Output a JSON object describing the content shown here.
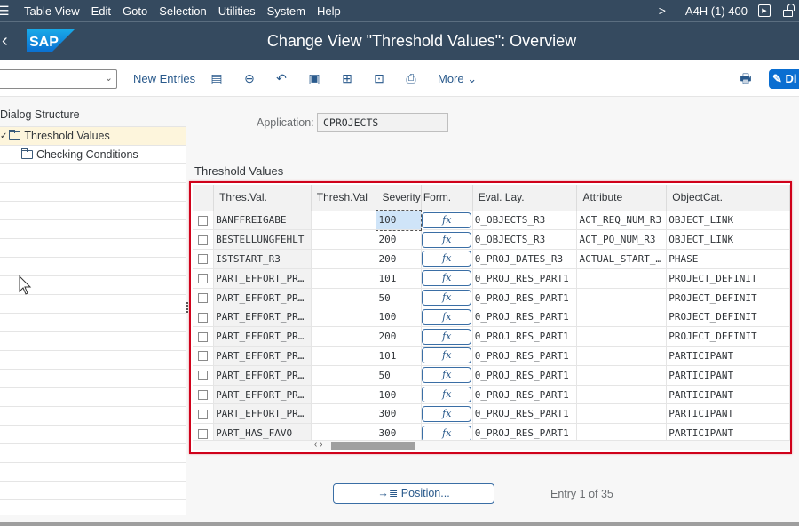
{
  "menu": {
    "items": [
      "Table View",
      "Edit",
      "Goto",
      "Selection",
      "Utilities",
      "System",
      "Help"
    ],
    "system_info": "A4H (1) 400"
  },
  "header": {
    "title": "Change View \"Threshold Values\": Overview",
    "logo_text": "SAP"
  },
  "toolbar": {
    "command_field_value": "",
    "new_entries": "New Entries",
    "more": "More",
    "display_button": "Di"
  },
  "dialog_structure": {
    "title": "Dialog Structure",
    "items": [
      {
        "label": "Threshold Values",
        "selected": true,
        "expanded": true
      },
      {
        "label": "Checking Conditions",
        "selected": false
      }
    ]
  },
  "main": {
    "application_label": "Application:",
    "application_value": "CPROJECTS",
    "section_title": "Threshold Values",
    "columns": [
      "Thres.Val.",
      "Thresh.Val",
      "Severity",
      "Form.",
      "Eval. Lay.",
      "Attribute",
      "ObjectCat."
    ],
    "form_button_label": "fx",
    "rows": [
      {
        "thres_val": "BANFFREIGABE",
        "thresh_val": "",
        "severity": "100",
        "eval_lay": "0_OBJECTS_R3",
        "attribute": "ACT_REQ_NUM_R3",
        "object_cat": "OBJECT_LINK"
      },
      {
        "thres_val": "BESTELLUNGFEHLT",
        "thresh_val": "",
        "severity": "200",
        "eval_lay": "0_OBJECTS_R3",
        "attribute": "ACT_PO_NUM_R3",
        "object_cat": "OBJECT_LINK"
      },
      {
        "thres_val": "ISTSTART_R3",
        "thresh_val": "",
        "severity": "200",
        "eval_lay": "0_PROJ_DATES_R3",
        "attribute": "ACTUAL_START_…",
        "object_cat": "PHASE"
      },
      {
        "thres_val": "PART_EFFORT_PR…",
        "thresh_val": "",
        "severity": "101",
        "eval_lay": "0_PROJ_RES_PART1",
        "attribute": "",
        "object_cat": "PROJECT_DEFINIT"
      },
      {
        "thres_val": "PART_EFFORT_PR…",
        "thresh_val": "",
        "severity": "50",
        "eval_lay": "0_PROJ_RES_PART1",
        "attribute": "",
        "object_cat": "PROJECT_DEFINIT"
      },
      {
        "thres_val": "PART_EFFORT_PR…",
        "thresh_val": "",
        "severity": "100",
        "eval_lay": "0_PROJ_RES_PART1",
        "attribute": "",
        "object_cat": "PROJECT_DEFINIT"
      },
      {
        "thres_val": "PART_EFFORT_PR…",
        "thresh_val": "",
        "severity": "200",
        "eval_lay": "0_PROJ_RES_PART1",
        "attribute": "",
        "object_cat": "PROJECT_DEFINIT"
      },
      {
        "thres_val": "PART_EFFORT_PR…",
        "thresh_val": "",
        "severity": "101",
        "eval_lay": "0_PROJ_RES_PART1",
        "attribute": "",
        "object_cat": "PARTICIPANT"
      },
      {
        "thres_val": "PART_EFFORT_PR…",
        "thresh_val": "",
        "severity": "50",
        "eval_lay": "0_PROJ_RES_PART1",
        "attribute": "",
        "object_cat": "PARTICIPANT"
      },
      {
        "thres_val": "PART_EFFORT_PR…",
        "thresh_val": "",
        "severity": "100",
        "eval_lay": "0_PROJ_RES_PART1",
        "attribute": "",
        "object_cat": "PARTICIPANT"
      },
      {
        "thres_val": "PART_EFFORT_PR…",
        "thresh_val": "",
        "severity": "300",
        "eval_lay": "0_PROJ_RES_PART1",
        "attribute": "",
        "object_cat": "PARTICIPANT"
      },
      {
        "thres_val": "PART_HAS_FAVO",
        "thresh_val": "",
        "severity": "300",
        "eval_lay": "0_PROJ_RES_PART1",
        "attribute": "",
        "object_cat": "PARTICIPANT"
      }
    ],
    "position_button": "Position...",
    "entry_info": "Entry 1 of 35"
  },
  "colors": {
    "shell": "#354a5f",
    "accent": "#0a6ed1",
    "highlight_border": "#d0021b",
    "selected_tree_row": "#fdf5dc"
  }
}
